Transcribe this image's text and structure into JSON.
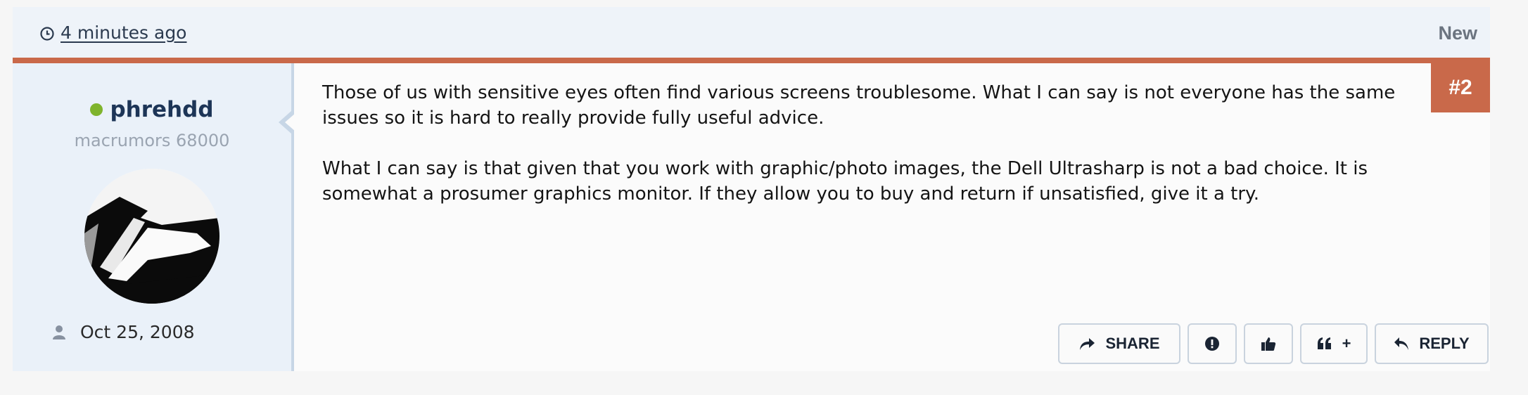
{
  "header": {
    "time": "4 minutes ago",
    "status": "New"
  },
  "post_number": "#2",
  "author": {
    "username": "phrehdd",
    "title": "macrumors 68000",
    "joined": "Oct 25, 2008",
    "online_color": "#7fb42d"
  },
  "content": {
    "paragraphs": [
      "Those of us with sensitive eyes often find various screens troublesome. What I can say is not everyone has the same issues so it is hard to really provide fully useful advice.",
      "What I can say is that given that you work with graphic/photo images, the Dell Ultrasharp is not a bad choice. It is somewhat a prosumer graphics monitor. If they allow you to buy and return if unsatisfied, give it a try."
    ]
  },
  "actions": {
    "share": "SHARE",
    "quote_plus": "+",
    "reply": "REPLY"
  },
  "colors": {
    "accent": "#c9694a",
    "header_bg": "#eef3f9",
    "sidebar_bg": "#eaf1f9"
  }
}
